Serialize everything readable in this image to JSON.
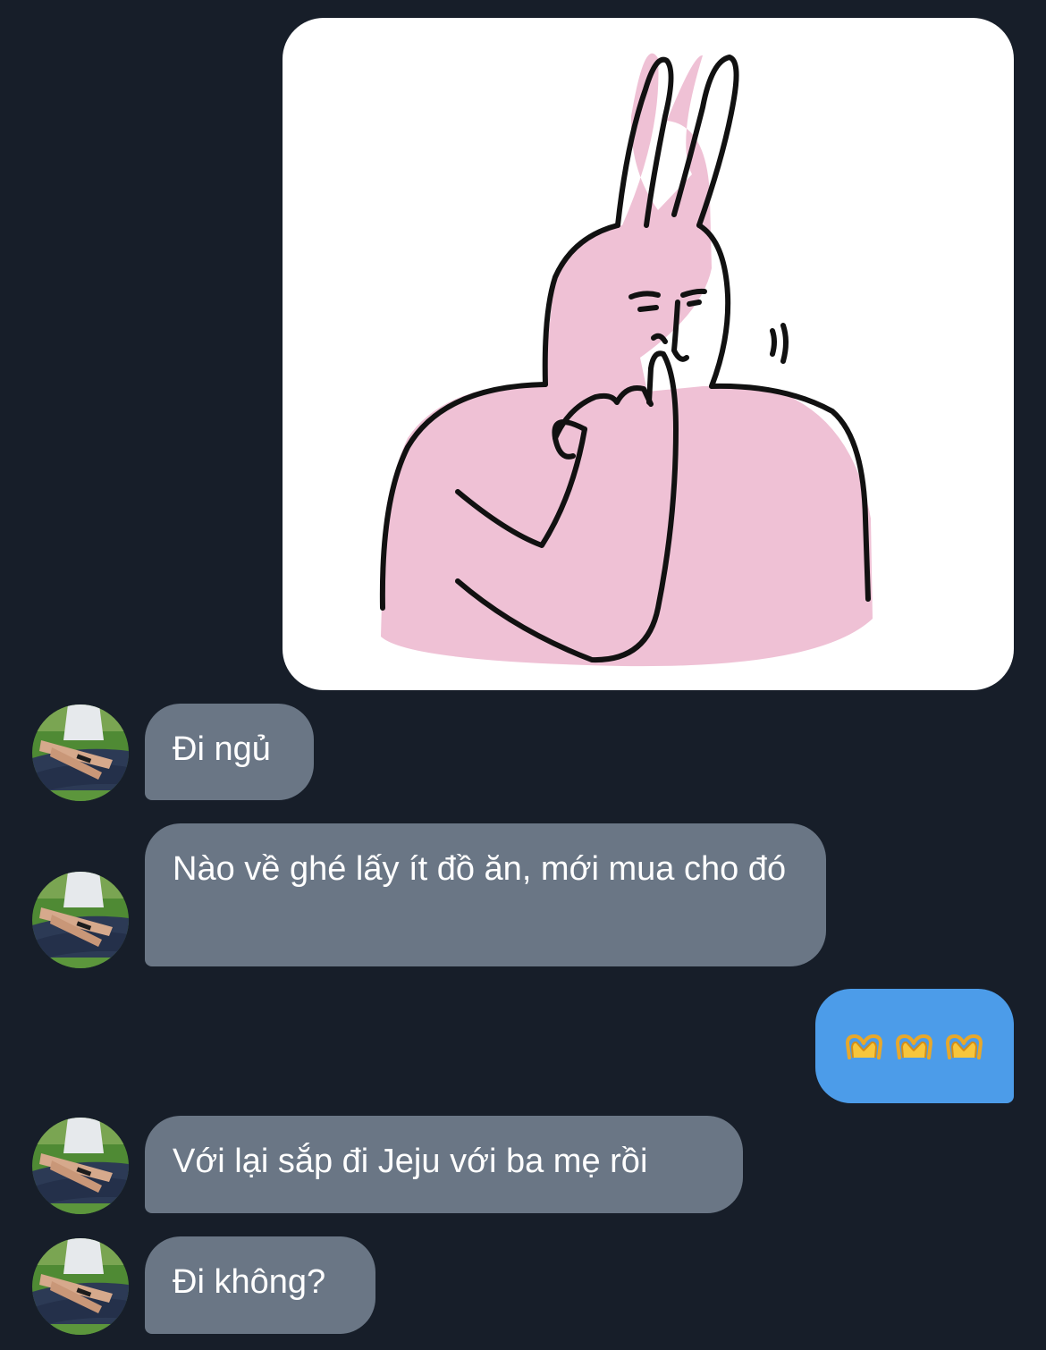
{
  "messages": [
    {
      "id": "sticker",
      "type": "sticker",
      "side": "outgoing",
      "sticker": "pink-rabbit-thinking-sticker"
    },
    {
      "id": "m1",
      "side": "incoming",
      "text": "Đi ngủ"
    },
    {
      "id": "m2",
      "side": "incoming",
      "text": "Nào về ghé lấy ít đồ ăn, mới mua cho đó"
    },
    {
      "id": "m3",
      "side": "outgoing",
      "type": "emoji",
      "emoji": [
        "heart-hands",
        "heart-hands",
        "heart-hands"
      ]
    },
    {
      "id": "m4",
      "side": "incoming",
      "text": "Với lại sắp đi Jeju với ba mẹ rồi"
    },
    {
      "id": "m5",
      "side": "incoming",
      "text": "Đi không?"
    }
  ],
  "colors": {
    "background": "#171e29",
    "incoming_bubble": "#6a7685",
    "outgoing_bubble": "#4c9ce9",
    "text": "#ffffff",
    "sticker_pink": "#efc1d5"
  },
  "icons": {
    "avatar": "contact-avatar-photo"
  }
}
